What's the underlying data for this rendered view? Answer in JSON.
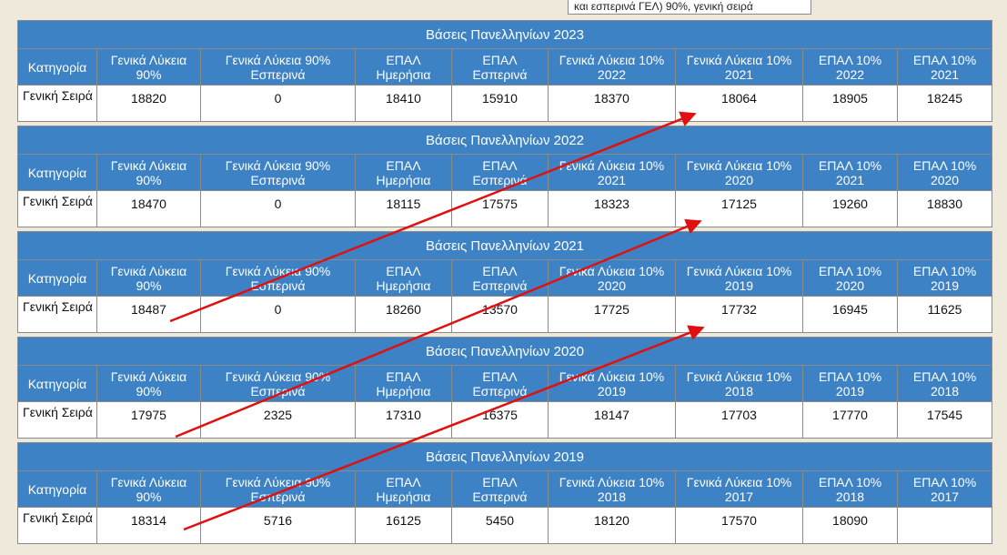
{
  "tooltip": "και εσπερινά ΓΕΛ) 90%, γενική σειρά",
  "tables": [
    {
      "title": "Βάσεις Πανελληνίων 2023",
      "headers": [
        "Κατηγορία",
        "Γενικά Λύκεια 90%",
        "Γενικά Λύκεια 90% Εσπερινά",
        "ΕΠΑΛ Ημερήσια",
        "ΕΠΑΛ Εσπερινά",
        "Γενικά Λύκεια 10% 2022",
        "Γενικά Λύκεια 10% 2021",
        "ΕΠΑΛ 10% 2022",
        "ΕΠΑΛ 10% 2021"
      ],
      "row": [
        "Γενική Σειρά",
        "18820",
        "0",
        "18410",
        "15910",
        "18370",
        "18064",
        "18905",
        "18245"
      ]
    },
    {
      "title": "Βάσεις Πανελληνίων 2022",
      "headers": [
        "Κατηγορία",
        "Γενικά Λύκεια 90%",
        "Γενικά Λύκεια 90% Εσπερινά",
        "ΕΠΑΛ Ημερήσια",
        "ΕΠΑΛ Εσπερινά",
        "Γενικά Λύκεια 10% 2021",
        "Γενικά Λύκεια 10% 2020",
        "ΕΠΑΛ 10% 2021",
        "ΕΠΑΛ 10% 2020"
      ],
      "row": [
        "Γενική Σειρά",
        "18470",
        "0",
        "18115",
        "17575",
        "18323",
        "17125",
        "19260",
        "18830"
      ]
    },
    {
      "title": "Βάσεις Πανελληνίων 2021",
      "headers": [
        "Κατηγορία",
        "Γενικά Λύκεια 90%",
        "Γενικά Λύκεια 90% Εσπερινά",
        "ΕΠΑΛ Ημερήσια",
        "ΕΠΑΛ Εσπερινά",
        "Γενικά Λύκεια 10% 2020",
        "Γενικά Λύκεια 10% 2019",
        "ΕΠΑΛ 10% 2020",
        "ΕΠΑΛ 10% 2019"
      ],
      "row": [
        "Γενική Σειρά",
        "18487",
        "0",
        "18260",
        "13570",
        "17725",
        "17732",
        "16945",
        "11625"
      ]
    },
    {
      "title": "Βάσεις Πανελληνίων 2020",
      "headers": [
        "Κατηγορία",
        "Γενικά Λύκεια 90%",
        "Γενικά Λύκεια 90% Εσπερινά",
        "ΕΠΑΛ Ημερήσια",
        "ΕΠΑΛ Εσπερινά",
        "Γενικά Λύκεια 10% 2019",
        "Γενικά Λύκεια 10% 2018",
        "ΕΠΑΛ 10% 2019",
        "ΕΠΑΛ 10% 2018"
      ],
      "row": [
        "Γενική Σειρά",
        "17975",
        "2325",
        "17310",
        "16375",
        "18147",
        "17703",
        "17770",
        "17545"
      ]
    },
    {
      "title": "Βάσεις Πανελληνίων 2019",
      "headers": [
        "Κατηγορία",
        "Γενικά Λύκεια 90%",
        "Γενικά Λύκεια 90% Εσπερινά",
        "ΕΠΑΛ Ημερήσια",
        "ΕΠΑΛ Εσπερινά",
        "Γενικά Λύκεια 10% 2018",
        "Γενικά Λύκεια 10% 2017",
        "ΕΠΑΛ 10% 2018",
        "ΕΠΑΛ 10% 2017"
      ],
      "row": [
        "Γενική Σειρά",
        "18314",
        "5716",
        "16125",
        "5450",
        "18120",
        "17570",
        "18090",
        ""
      ]
    }
  ],
  "annotation_color": "#e01010"
}
